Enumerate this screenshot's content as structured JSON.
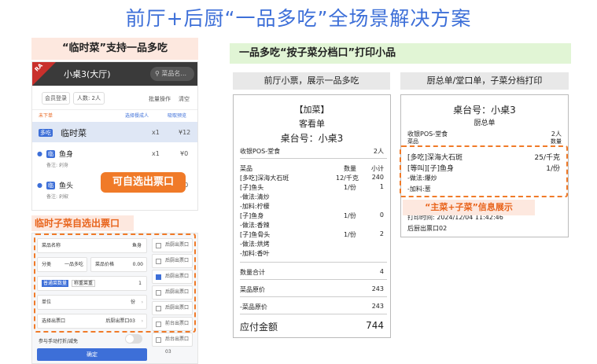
{
  "title": "前厅+后厨“一品多吃”全场景解决方案",
  "left": {
    "header": "“临时菜”支持一品多吃",
    "phone": {
      "corner_badge": "RA",
      "table": "小桌3(大厅)",
      "search_placeholder": "菜品名...",
      "member_login": "会员登录",
      "people": "人数: 2人",
      "batch": "批量操作",
      "clear": "清空",
      "not_ordered": "未下单",
      "select_person": "选择餐成人",
      "order_preview": "吸取预览",
      "items": [
        {
          "tag": "多吃",
          "name": "临时菜",
          "qty": "x1",
          "price": "¥12",
          "note": ""
        },
        {
          "tag": "临",
          "name": "鱼身",
          "qty": "x1",
          "price": "¥0",
          "note": "备注: 剁身"
        },
        {
          "tag": "临",
          "name": "鱼头",
          "qty": "x1",
          "price": "¥0",
          "note": "备注: 剁椒"
        }
      ]
    },
    "float_button": "可自选出票口",
    "header2": "临时子菜自选出票口",
    "form": {
      "dish_name_label": "菜品名称",
      "dish_name_value": "鱼身",
      "category_label": "分类",
      "category_value": "一品多吃",
      "price_label": "菜品价格",
      "price_value": "0.00",
      "qty_tab": "普通菜数量",
      "weigh_tab": "称重菜重",
      "qty_value": "1",
      "unit_label": "单位",
      "unit_value": "份",
      "outlet_label": "选择出票口",
      "outlet_value": "后厨出票口03",
      "toggle_label": "参与手动打折/减免",
      "confirm": "确定",
      "outlets": [
        {
          "label": "后厨出票口11",
          "checked": false
        },
        {
          "label": "后厨出票口23",
          "checked": false
        },
        {
          "label": "后厨出票口03",
          "checked": true
        },
        {
          "label": "后厨出票口12",
          "checked": false
        },
        {
          "label": "后厨出票口",
          "checked": false
        },
        {
          "label": "前台出票口03",
          "checked": false
        },
        {
          "label": "后台出票口03",
          "checked": false
        }
      ]
    }
  },
  "right": {
    "header": "一品多吃“按子菜分档口”打印小品",
    "front": {
      "subheader": "前厅小票，展示一品多吃",
      "title1": "【加菜】",
      "title2": "客看单",
      "table": "桌台号：小桌3",
      "store": "收银POS-堂食",
      "people": "2人",
      "col_item": "菜品",
      "col_qty": "数量",
      "col_subtotal": "小计",
      "lines": [
        {
          "name": "[多吃]深海大石斑",
          "qty": "12/千克",
          "sub": "240"
        },
        {
          "name": "[子]鱼头",
          "qty": "1/份",
          "sub": "1"
        },
        {
          "name": "-做法:清炒",
          "qty": "",
          "sub": ""
        },
        {
          "name": "-加料:柠檬",
          "qty": "",
          "sub": ""
        },
        {
          "name": "[子]鱼身",
          "qty": "1/份",
          "sub": "0"
        },
        {
          "name": "-做法:香辣",
          "qty": "",
          "sub": ""
        },
        {
          "name": "[子]鱼骨头",
          "qty": "1/份",
          "sub": "2"
        },
        {
          "name": "-做法:烘烤",
          "qty": "",
          "sub": ""
        },
        {
          "name": "-加料:香叶",
          "qty": "",
          "sub": ""
        }
      ],
      "qty_total_label": "数量合计",
      "qty_total_value": "4",
      "orig_label": "菜品原价",
      "orig_value": "243",
      "orig2_label": "-菜品原价",
      "orig2_value": "243",
      "pay_label": "应付金额",
      "pay_value": "744"
    },
    "kitchen": {
      "subheader": "厨总单/堂口单，子菜分档打印",
      "table": "桌台号：小桌3",
      "title": "厨总单",
      "store": "收银POS-堂食",
      "people": "2人",
      "col_item": "菜品",
      "col_qty": "数量",
      "lines": [
        {
          "name": "[多吃]深海大石斑",
          "qty": "25/千克"
        },
        {
          "name": "[等叫][子]鱼身",
          "qty": "1/份"
        },
        {
          "name": "-做法:爆炒",
          "qty": ""
        },
        {
          "name": "-加料:葱",
          "qty": ""
        }
      ],
      "print_time": "打印时间: 2024/12/04 11:42:46",
      "outlet": "后厨出票口02",
      "info_label": "“主菜+子菜”信息展示"
    }
  }
}
